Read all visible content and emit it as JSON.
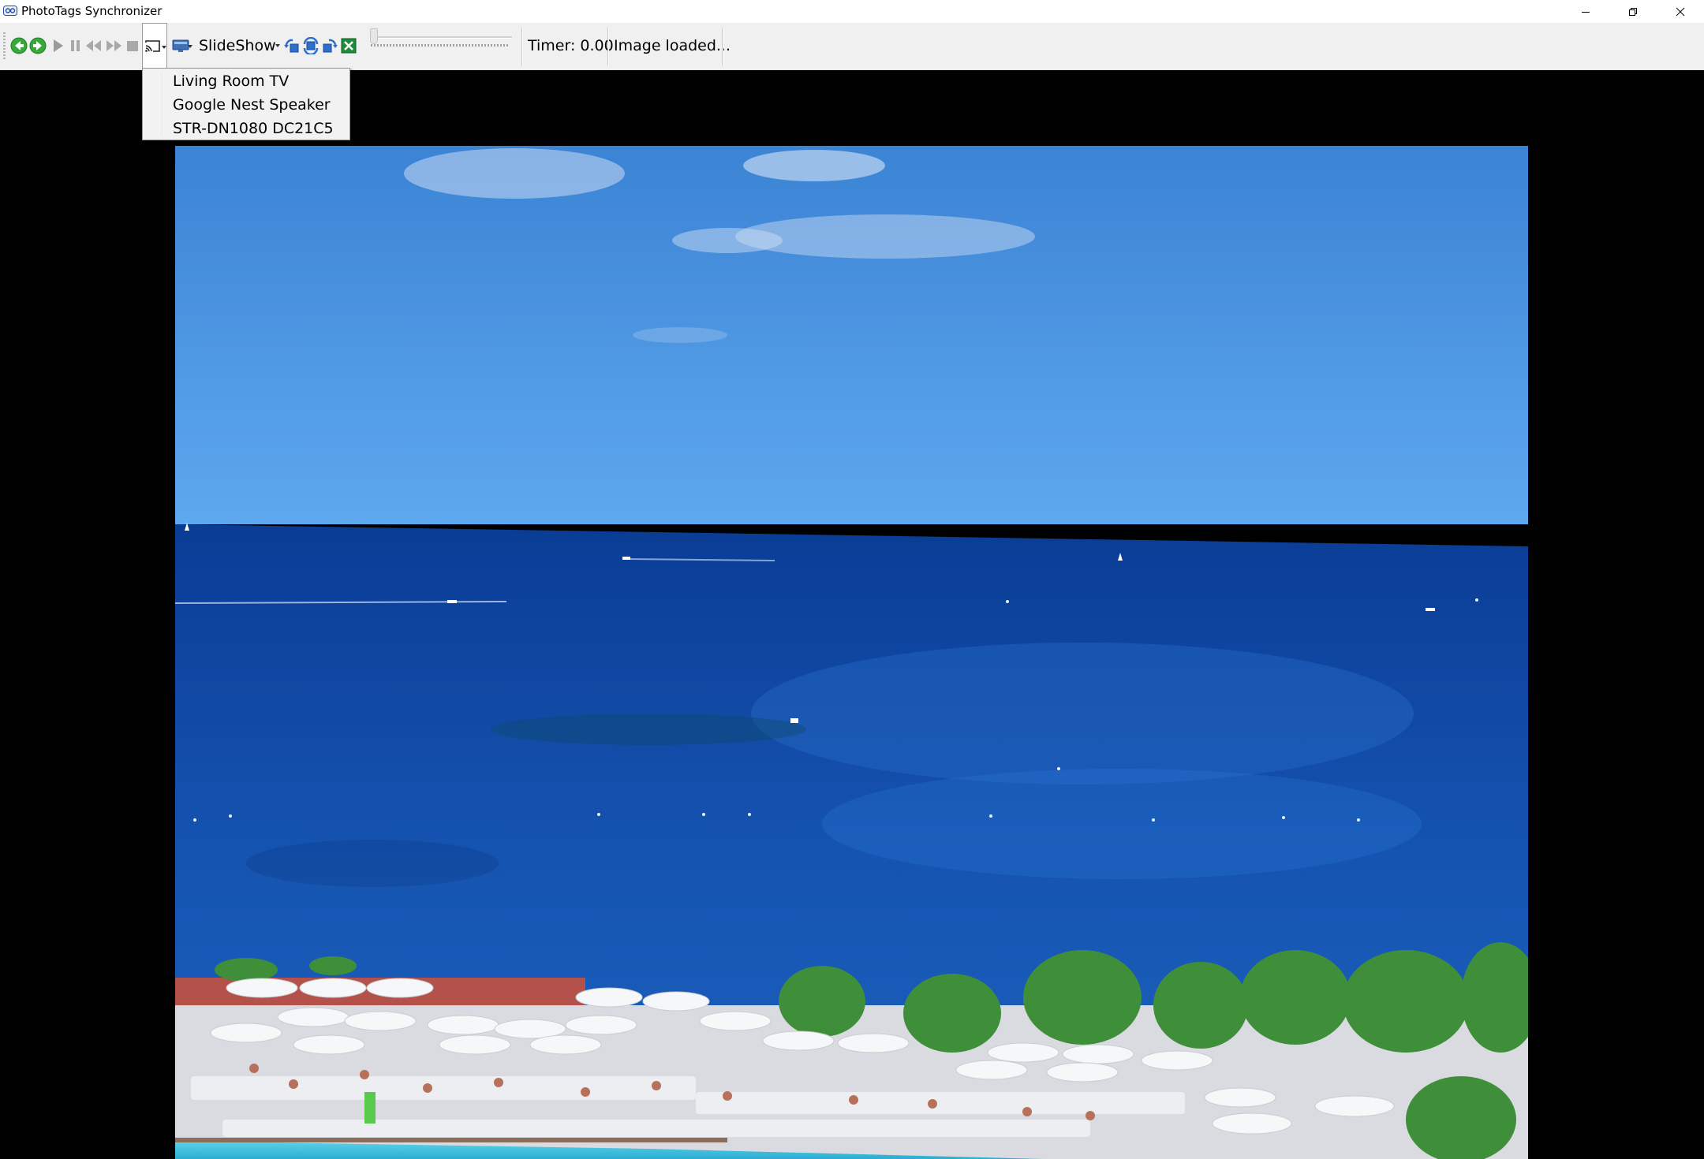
{
  "window": {
    "title": "PhotoTags Synchronizer",
    "app_icon": "phototags-app-icon",
    "controls": [
      "minimize-icon",
      "restore-icon",
      "close-icon"
    ]
  },
  "toolbar": {
    "buttons": [
      {
        "name": "previous-green-icon"
      },
      {
        "name": "next-green-icon"
      },
      {
        "name": "play-icon"
      },
      {
        "name": "pause-icon"
      },
      {
        "name": "rewind-icon"
      },
      {
        "name": "fast-forward-icon"
      },
      {
        "name": "stop-icon"
      },
      {
        "name": "cast-icon"
      },
      {
        "name": "monitor-icon"
      }
    ],
    "slideshow_label": "SlideShow",
    "rotate_buttons": [
      "rotate-left-icon",
      "rotate-180-icon",
      "rotate-right-icon",
      "close-excel-icon"
    ],
    "slider_position": 0,
    "timer_text": "Timer: 0.00",
    "status_text": "Image loaded..."
  },
  "cast_menu": {
    "items": [
      "Living Room TV",
      "Google Nest Speaker",
      "STR-DN1080 DC21C5"
    ]
  },
  "colors": {
    "sky_top": "#3a86d6",
    "sky_bottom": "#5aa6ee",
    "sea_top": "#0b3f9a",
    "sea_bottom": "#1a5bb7",
    "toolbar_bg": "#f0f0f0",
    "green_icon": "#2fa52f",
    "blue_icon": "#2d6fd0"
  }
}
